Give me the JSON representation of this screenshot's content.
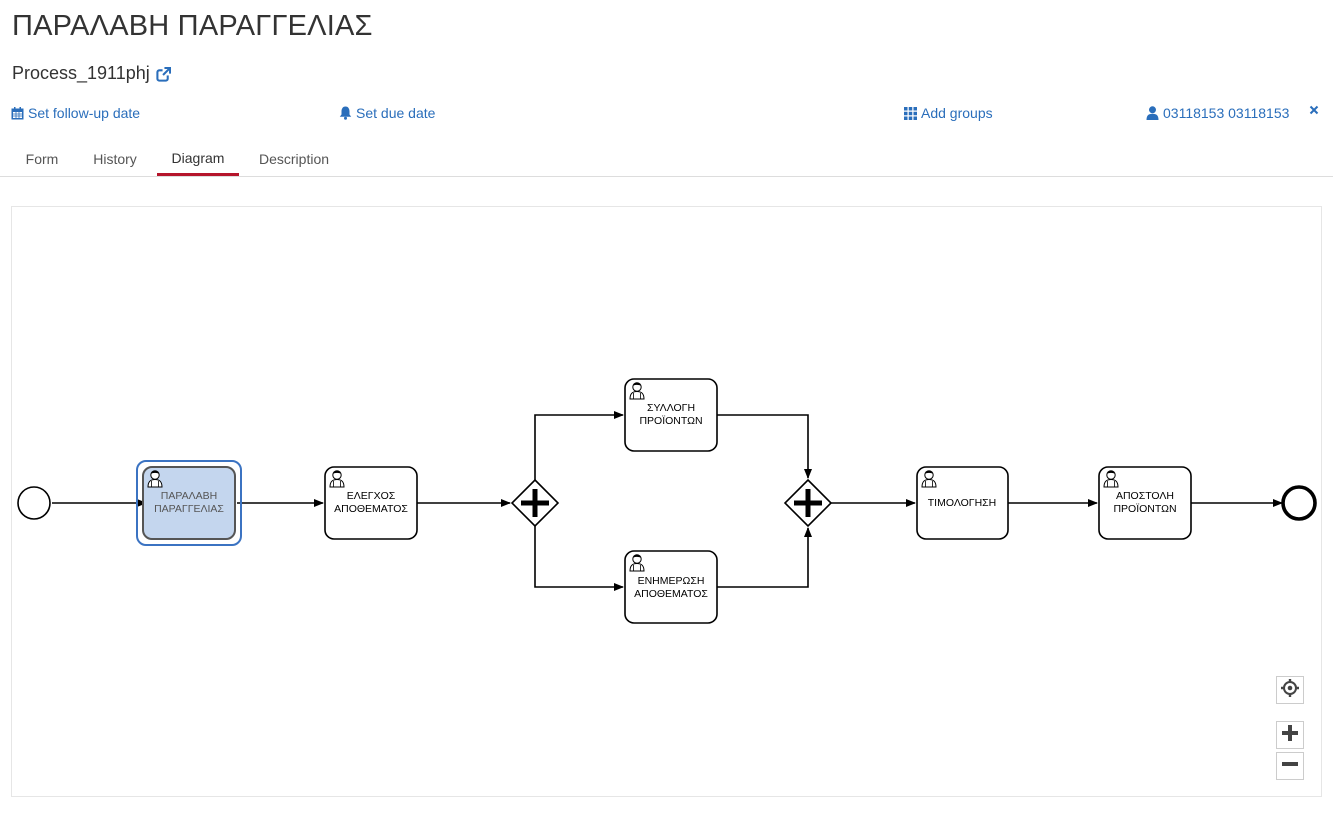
{
  "header": {
    "title": "ΠΑΡΑΛΑΒΗ ΠΑΡΑΓΓΕΛΙΑΣ",
    "process": "Process_1911phj"
  },
  "actions": {
    "follow_up": "Set follow-up date",
    "due": "Set due date",
    "groups": "Add groups",
    "assignee": "03118153 03118153"
  },
  "tabs": [
    "Form",
    "History",
    "Diagram",
    "Description"
  ],
  "active_tab": "Diagram",
  "diagram": {
    "tasks": [
      {
        "id": "receive",
        "lines": [
          "ΠΑΡΑΛΑΒΗ",
          "ΠΑΡΑΓΓΕΛΙΑΣ"
        ],
        "highlighted": true
      },
      {
        "id": "stock-check",
        "lines": [
          "ΕΛΕΓΧΟΣ",
          "ΑΠΟΘΕΜΑΤΟΣ"
        ]
      },
      {
        "id": "collect",
        "lines": [
          "ΣΥΛΛΟΓΗ",
          "ΠΡΟΪΟΝΤΩΝ"
        ]
      },
      {
        "id": "update-stock",
        "lines": [
          "ΕΝΗΜΕΡΩΣΗ",
          "ΑΠΟΘΕΜΑΤΟΣ"
        ]
      },
      {
        "id": "invoice",
        "lines": [
          "ΤΙΜΟΛΟΓΗΣΗ"
        ]
      },
      {
        "id": "ship",
        "lines": [
          "ΑΠΟΣΤΟΛΗ",
          "ΠΡΟΪΟΝΤΩΝ"
        ]
      }
    ],
    "highlight_color": "#c4d6ee",
    "highlight_border": "#3b73c2"
  },
  "colors": {
    "link": "#2a6ebb",
    "tab_active": "#b5152b"
  }
}
